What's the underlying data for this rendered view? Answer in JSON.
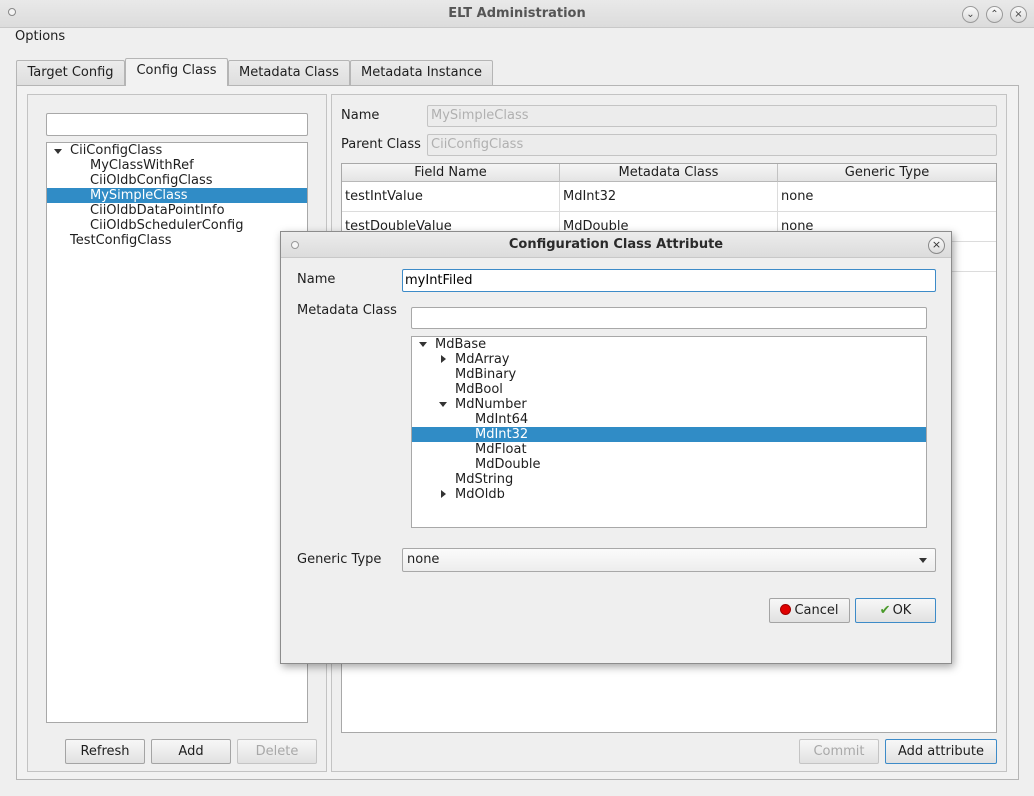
{
  "window": {
    "title": "ELT Administration"
  },
  "menu": {
    "options": "Options"
  },
  "tabs": [
    "Target Config",
    "Config Class",
    "Metadata Class",
    "Metadata Instance"
  ],
  "left": {
    "search_value": "",
    "tree": [
      {
        "label": "CiiConfigClass",
        "level": 0,
        "expanded": true
      },
      {
        "label": "MyClassWithRef",
        "level": 1
      },
      {
        "label": "CiiOldbConfigClass",
        "level": 1
      },
      {
        "label": "MySimpleClass",
        "level": 1,
        "selected": true
      },
      {
        "label": "CiiOldbDataPointInfo",
        "level": 1
      },
      {
        "label": "CiiOldbSchedulerConfig",
        "level": 1
      },
      {
        "label": "TestConfigClass",
        "level": 0
      }
    ],
    "buttons": {
      "refresh": "Refresh",
      "add": "Add",
      "delete": "Delete"
    }
  },
  "right": {
    "name_label": "Name",
    "name_value": "MySimpleClass",
    "parent_label": "Parent Class",
    "parent_value": "CiiConfigClass",
    "table": {
      "headers": [
        "Field Name",
        "Metadata Class",
        "Generic Type"
      ],
      "rows": [
        [
          "testIntValue",
          "MdInt32",
          "none"
        ],
        [
          "testDoubleValue",
          "MdDouble",
          "none"
        ],
        [
          "",
          "",
          ""
        ]
      ]
    },
    "buttons": {
      "commit": "Commit",
      "add_attribute": "Add attribute"
    }
  },
  "dialog": {
    "title": "Configuration Class Attribute",
    "name_label": "Name",
    "name_value": "myIntFiled",
    "metadata_label": "Metadata Class",
    "metadata_filter": "",
    "tree": [
      {
        "label": "MdBase",
        "level": 0,
        "expander": "open"
      },
      {
        "label": "MdArray",
        "level": 1,
        "expander": "closed"
      },
      {
        "label": "MdBinary",
        "level": 1
      },
      {
        "label": "MdBool",
        "level": 1
      },
      {
        "label": "MdNumber",
        "level": 1,
        "expander": "open"
      },
      {
        "label": "MdInt64",
        "level": 2
      },
      {
        "label": "MdInt32",
        "level": 2,
        "selected": true
      },
      {
        "label": "MdFloat",
        "level": 2
      },
      {
        "label": "MdDouble",
        "level": 2
      },
      {
        "label": "MdString",
        "level": 1
      },
      {
        "label": "MdOldb",
        "level": 1,
        "expander": "closed"
      }
    ],
    "generic_label": "Generic Type",
    "generic_value": "none",
    "cancel_label": "Cancel",
    "ok_label": "OK"
  },
  "colors": {
    "selection": "#308cc6",
    "cancel_icon": "#e00000",
    "ok_icon": "#4a9a2a"
  }
}
